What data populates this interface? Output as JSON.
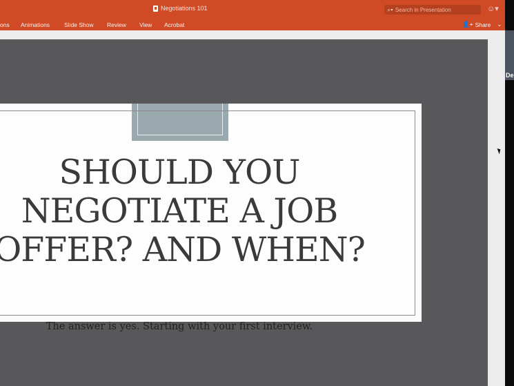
{
  "app": {
    "doc_title": "Negotiations 101",
    "search_placeholder": "Search in Presentation"
  },
  "menu": {
    "items": [
      "ons",
      "Animations",
      "Slide Show",
      "Review",
      "View",
      "Acrobat"
    ],
    "share_label": "Share"
  },
  "slide": {
    "title": "SHOULD YOU\nNEGOTIATE A JOB\nOFFER? AND WHEN?",
    "subtitle": "The answer is yes. Starting with your first interview."
  },
  "video_panel": {
    "participant_label": "De"
  },
  "icons": {
    "doc": "powerpoint-doc-icon",
    "search": "search-icon",
    "feedback": "smiley-icon",
    "share": "add-person-icon",
    "chevron": "chevron-down-icon"
  },
  "colors": {
    "ribbon": "#d04a25",
    "canvas": "#58585a",
    "slide_accent": "#9aa9ad"
  }
}
